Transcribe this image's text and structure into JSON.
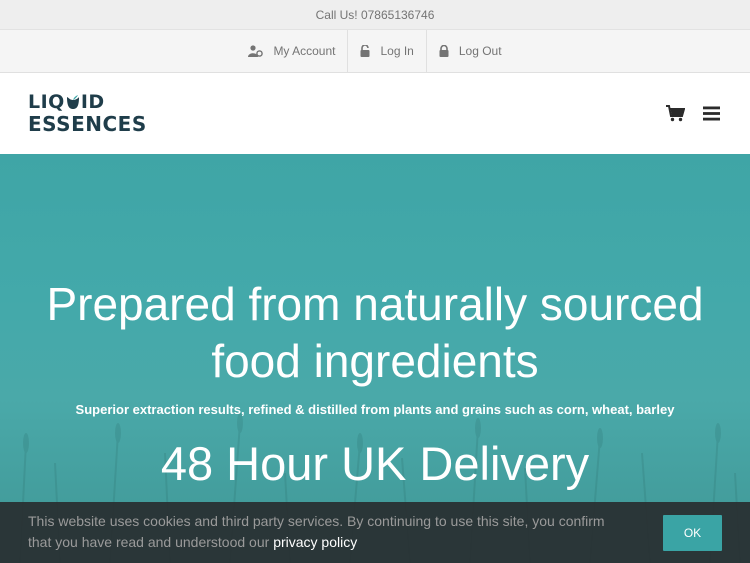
{
  "topbar": {
    "call_text": "Call Us! 07865136746"
  },
  "account_nav": [
    {
      "label": "My Account",
      "icon": "user-gear-icon"
    },
    {
      "label": "Log In",
      "icon": "unlock-icon"
    },
    {
      "label": "Log Out",
      "icon": "lock-icon"
    }
  ],
  "header": {
    "logo_line1_a": "LIQ",
    "logo_line1_b": "ID",
    "logo_line2": "ESSENCES",
    "icons": [
      "cart-icon",
      "menu-icon"
    ]
  },
  "hero": {
    "title_line1": "Prepared from naturally sourced",
    "title_line2": "food ingredients",
    "subtitle": "Superior extraction results, refined & distilled from plants and grains such as corn, wheat, barley",
    "delivery": "48 Hour UK Delivery"
  },
  "cookie": {
    "text_line1": "This website uses cookies and third party services. By continuing to use this site, you confirm",
    "text_line2": "that you have read and understood our ",
    "link": "privacy policy",
    "ok_label": "OK"
  },
  "colors": {
    "brand": "#1f3d4a",
    "hero": "#43a9aa",
    "button": "#3aa4a5"
  }
}
